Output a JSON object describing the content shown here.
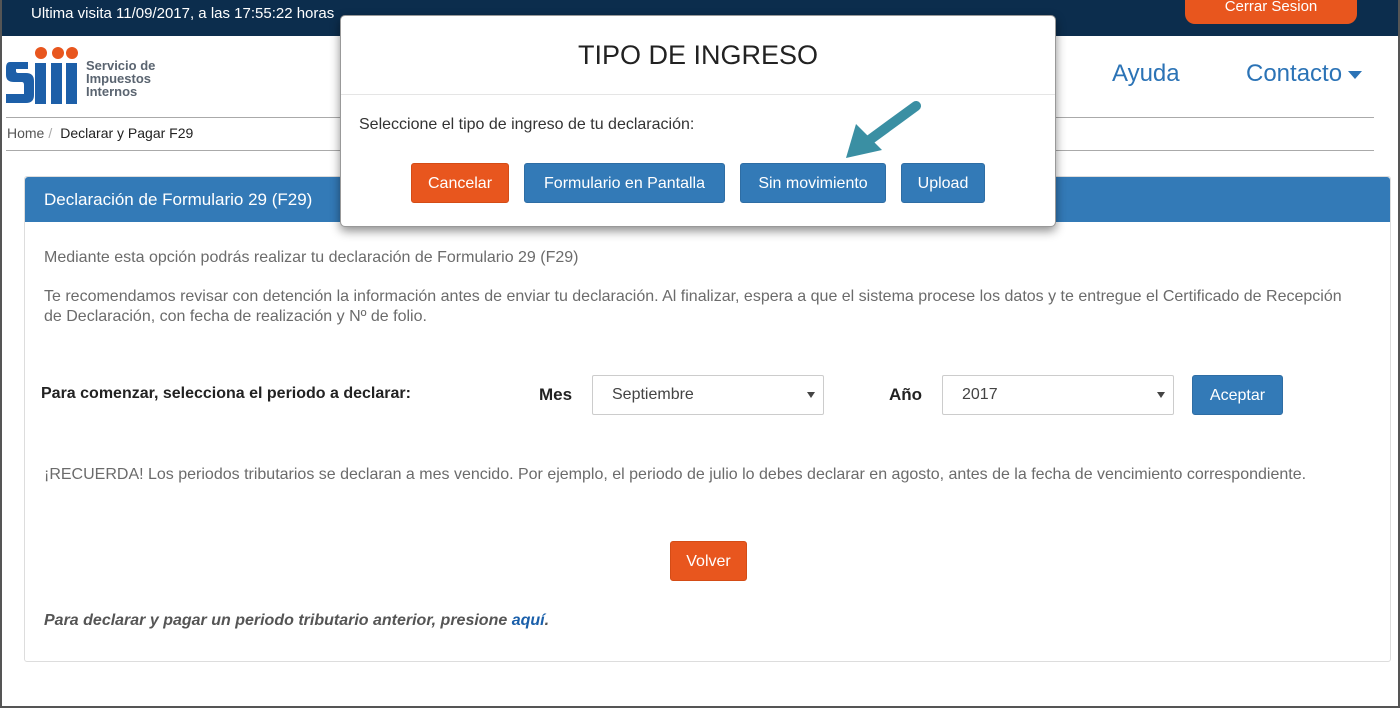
{
  "topbar": {
    "last_visit": "Ultima visita 11/09/2017, a las 17:55:22 horas",
    "logout": "Cerrar Sesion"
  },
  "logo": {
    "line1": "Servicio de",
    "line2": "Impuestos",
    "line3": "Internos"
  },
  "nav": {
    "help": "Ayuda",
    "contact": "Contacto"
  },
  "breadcrumb": {
    "home": "Home",
    "separator": "/",
    "current": "Declarar y Pagar F29"
  },
  "panel": {
    "title": "Declaración de Formulario 29 (F29)",
    "intro": "Mediante esta opción podrás realizar tu declaración de Formulario 29 (F29)",
    "recommend": "Te recomendamos revisar con detención la información antes de enviar tu declaración. Al finalizar, espera a que el sistema procese los datos y te entregue el Certificado de Recepción de Declaración, con fecha de realización y Nº de folio.",
    "period_label": "Para comenzar, selecciona el periodo a declarar:",
    "month_label": "Mes",
    "month_value": "Septiembre",
    "year_label": "Año",
    "year_value": "2017",
    "accept": "Aceptar",
    "reminder": "¡RECUERDA! Los periodos tributarios se declaran a mes vencido. Por ejemplo, el periodo de julio lo debes declarar en agosto, antes de la fecha de vencimiento correspondiente.",
    "back": "Volver",
    "note_prefix": "Para declarar y pagar un periodo tributario anterior, presione ",
    "note_link": "aquí",
    "note_suffix": "."
  },
  "modal": {
    "title": "TIPO DE INGRESO",
    "text": "Seleccione el tipo de ingreso de tu declaración:",
    "cancel": "Cancelar",
    "on_screen": "Formulario en Pantalla",
    "no_movement": "Sin movimiento",
    "upload": "Upload"
  },
  "colors": {
    "topbar": "#0c2d4d",
    "primary": "#337ab7",
    "accent": "#e8561e",
    "arrow": "#3a8fa3"
  },
  "icons": {
    "dropdown": "caret-down-icon",
    "pointer": "arrow-pointer-icon"
  }
}
